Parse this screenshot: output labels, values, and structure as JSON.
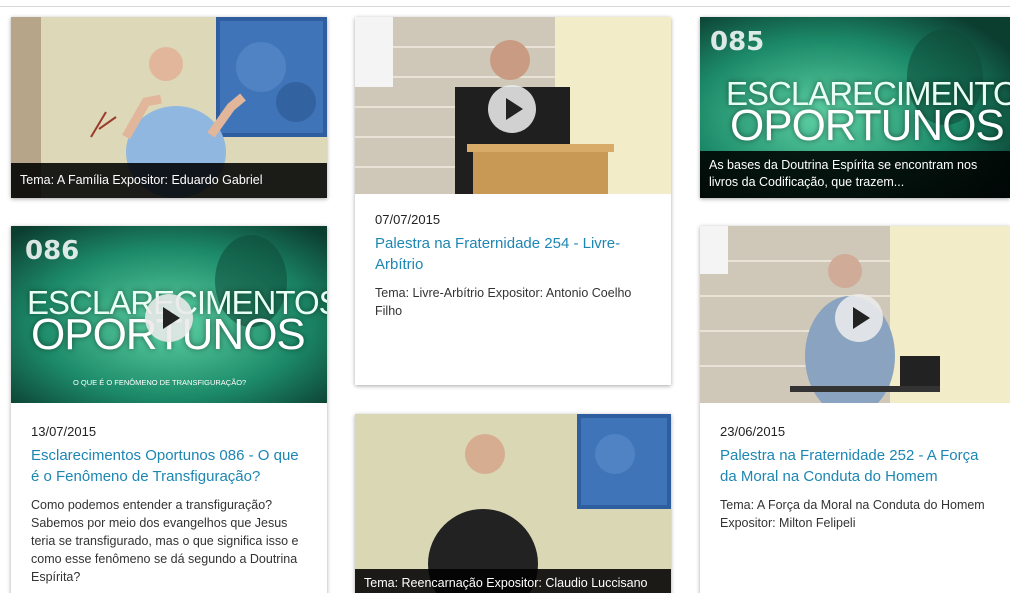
{
  "cards": [
    {
      "overlay": "Tema: A Família Expositor: Eduardo Gabriel"
    },
    {
      "date": "07/07/2015",
      "title": "Palestra na Fraternidade 254 - Livre-Arbítrio",
      "desc": "Tema: Livre-Arbítrio Expositor: Antonio Coelho Filho"
    },
    {
      "thumb_number": "085",
      "thumb_line1": "ESCLARECIMENTOS",
      "thumb_line2": "OPORTUNOS",
      "overlay": "As bases da Doutrina Espírita se encontram nos livros da Codificação, que trazem..."
    },
    {
      "thumb_number": "086",
      "thumb_line1": "ESCLARECIMENTOS",
      "thumb_line2": "OPORTUNOS",
      "thumb_subtitle": "O QUE É O FENÔMENO DE TRANSFIGURAÇÃO?",
      "date": "13/07/2015",
      "title": "Esclarecimentos Oportunos 086 - O que é o Fenômeno de Transfiguração?",
      "desc": "Como podemos entender a transfiguração? Sabemos por meio dos evangelhos que Jesus teria se transfigurado, mas o que significa isso e como esse fenômeno se dá segundo a Doutrina Espírita?"
    },
    {
      "overlay": "Tema: Reencarnação Expositor: Claudio Luccisano"
    },
    {
      "date": "23/06/2015",
      "title": "Palestra na Fraternidade 252 - A Força da Moral na Conduta do Homem",
      "desc": "Tema: A Força da Moral na Conduta do Homem Expositor: Milton Felipeli"
    }
  ],
  "colors": {
    "link": "#1d86b3",
    "overlay_bg": "#000000",
    "eo_green": "#1c8a68"
  },
  "icons": [
    "play-icon"
  ]
}
